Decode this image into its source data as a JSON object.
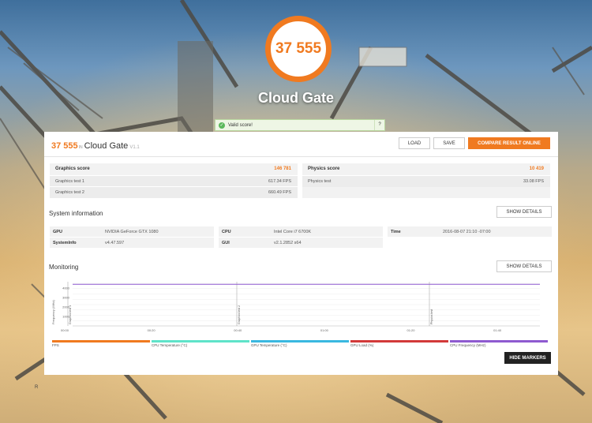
{
  "score_circle": "37 555",
  "benchmark_title": "Cloud Gate",
  "valid_notice": {
    "text": "Valid score!",
    "help": "?"
  },
  "header": {
    "score": "37 555",
    "pts": "IN",
    "name": "Cloud Gate",
    "version": "V1.1",
    "load_label": "LOAD",
    "save_label": "SAVE",
    "compare_label": "COMPARE RESULT ONLINE"
  },
  "graphics": {
    "label": "Graphics score",
    "value": "146 781",
    "tests": [
      {
        "label": "Graphics test 1",
        "value": "617.34 FPS"
      },
      {
        "label": "Graphics test 2",
        "value": "660.49 FPS"
      }
    ]
  },
  "physics": {
    "label": "Physics score",
    "value": "10 419",
    "tests": [
      {
        "label": "Physics test",
        "value": "33.08 FPS"
      }
    ]
  },
  "system": {
    "title": "System information",
    "show_details": "SHOW DETAILS",
    "items": [
      {
        "key": "GPU",
        "value": "NVIDIA GeForce GTX 1080"
      },
      {
        "key": "CPU",
        "value": "Intel Core i7 6700K"
      },
      {
        "key": "Time",
        "value": "2016-08-07 21:10 -07:00"
      },
      {
        "key": "SystemInfo",
        "value": "v4.47.597"
      },
      {
        "key": "GUI",
        "value": "v2.1.2852 s64"
      }
    ]
  },
  "monitoring": {
    "title": "Monitoring",
    "show_details": "SHOW DETAILS",
    "hide_markers": "HIDE MARKERS",
    "y_axis_label": "Frequency (MHz)",
    "y_ticks": [
      "4000",
      "3000",
      "2000",
      "1000"
    ],
    "x_ticks": [
      "00:00",
      "00:20",
      "00:40",
      "01:00",
      "01:20",
      "01:40"
    ],
    "markers": [
      "Graphics test 1",
      "Graphics test 2",
      "Physics test"
    ],
    "legend": [
      {
        "label": "FPS",
        "color": "#f07a20"
      },
      {
        "label": "CPU Temperature (°C)",
        "color": "#5fe3c9"
      },
      {
        "label": "GPU Temperature (°C)",
        "color": "#3ab8e0"
      },
      {
        "label": "GPU Load (%)",
        "color": "#d23a3a"
      },
      {
        "label": "CPU Frequency (MHz)",
        "color": "#8e5ad0"
      }
    ]
  },
  "chart_data": {
    "type": "line",
    "ylabel": "Frequency (MHz)",
    "ylim": [
      0,
      4500
    ],
    "x": [
      "00:00",
      "00:20",
      "00:40",
      "01:00",
      "01:20",
      "01:40",
      "01:50"
    ],
    "series": [
      {
        "name": "CPU Frequency (MHz)",
        "values": [
          4400,
          4400,
          4400,
          4400,
          4400,
          4400,
          4400
        ]
      }
    ]
  },
  "corner_text": "R",
  "colors": {
    "accent": "#f07a20"
  }
}
